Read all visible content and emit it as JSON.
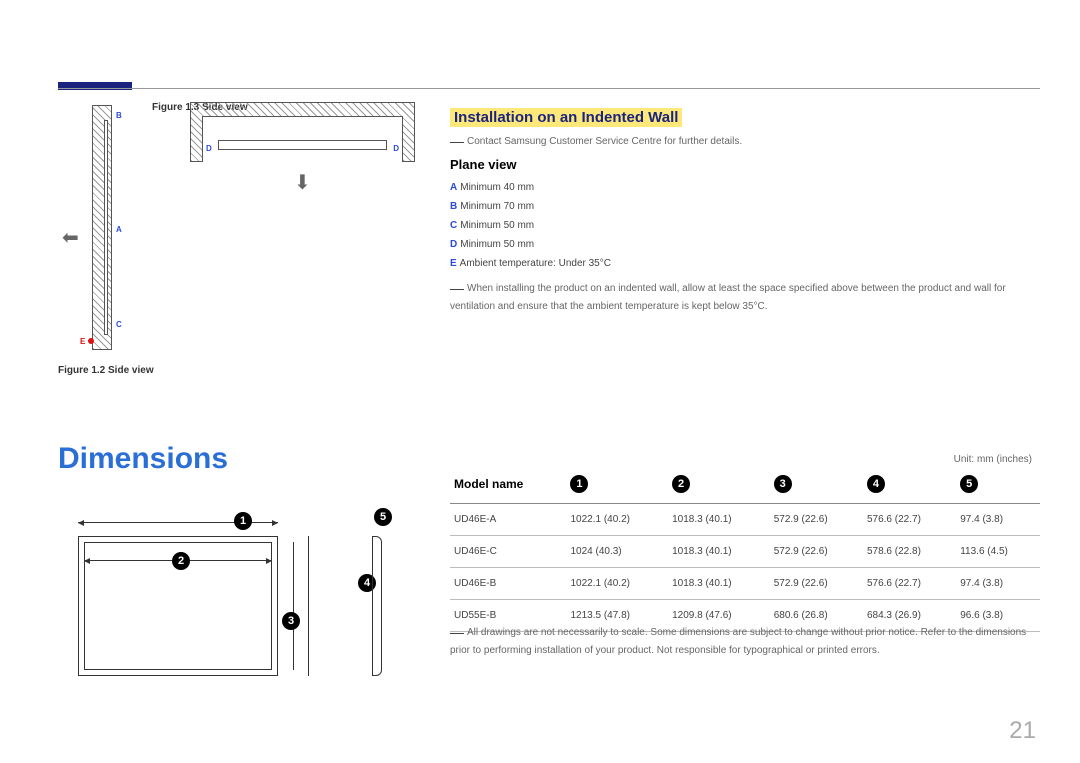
{
  "figures": {
    "fig13_caption": "Figure 1.3 Side view",
    "fig12_caption": "Figure 1.2 Side view",
    "labels": {
      "a": "A",
      "b": "B",
      "c": "C",
      "d": "D",
      "e": "E"
    }
  },
  "section": {
    "title": "Installation on an Indented Wall",
    "contact_note": "Contact Samsung Customer Service Centre for further details.",
    "plane_view": "Plane view",
    "specs": {
      "a": "Minimum 40 mm",
      "b": "Minimum 70 mm",
      "c": "Minimum 50 mm",
      "d": "Minimum 50 mm",
      "e": "Ambient temperature: Under 35°C"
    },
    "install_note": "When installing the product on an indented wall, allow at least the space specified above between the product and wall for ventilation and ensure that the ambient temperature is kept below 35°C."
  },
  "dimensions": {
    "heading": "Dimensions",
    "unit_label": "Unit: mm (inches)",
    "col_model": "Model name",
    "markers": {
      "c1": "1",
      "c2": "2",
      "c3": "3",
      "c4": "4",
      "c5": "5"
    },
    "rows": [
      {
        "model": "UD46E-A",
        "v1": "1022.1 (40.2)",
        "v2": "1018.3 (40.1)",
        "v3": "572.9 (22.6)",
        "v4": "576.6 (22.7)",
        "v5": "97.4 (3.8)"
      },
      {
        "model": "UD46E-C",
        "v1": "1024 (40.3)",
        "v2": "1018.3 (40.1)",
        "v3": "572.9 (22.6)",
        "v4": "578.6 (22.8)",
        "v5": "113.6 (4.5)"
      },
      {
        "model": "UD46E-B",
        "v1": "1022.1 (40.2)",
        "v2": "1018.3 (40.1)",
        "v3": "572.9 (22.6)",
        "v4": "576.6 (22.7)",
        "v5": "97.4 (3.8)"
      },
      {
        "model": "UD55E-B",
        "v1": "1213.5 (47.8)",
        "v2": "1209.8 (47.6)",
        "v3": "680.6 (26.8)",
        "v4": "684.3 (26.9)",
        "v5": "96.6 (3.8)"
      }
    ],
    "table_note": "All drawings are not necessarily to scale. Some dimensions are subject to change without prior notice. Refer to the dimensions prior to performing installation of your product. Not responsible for typographical or printed errors."
  },
  "page_number": "21"
}
